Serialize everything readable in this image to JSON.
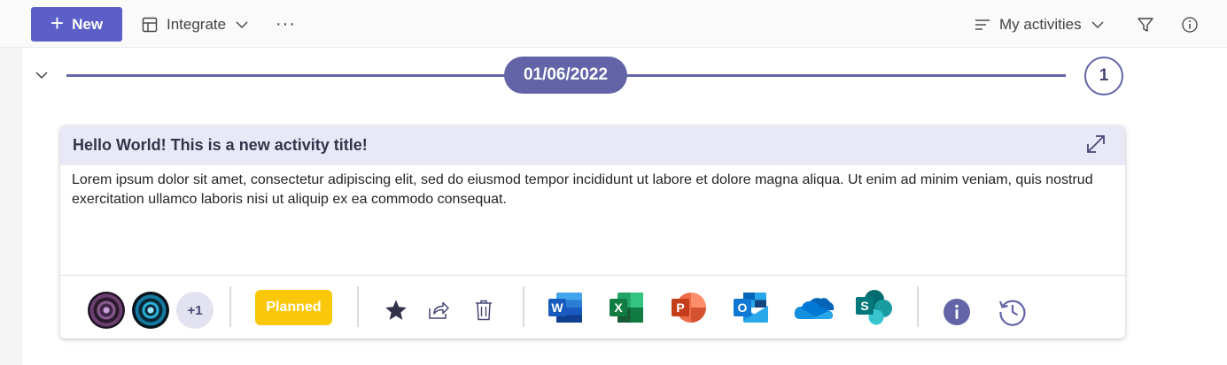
{
  "toolbar": {
    "new_label": "New",
    "integrate_label": "Integrate",
    "more_label": "···",
    "view_label": "My activities"
  },
  "timeline": {
    "date": "01/06/2022",
    "count": "1"
  },
  "activity": {
    "title": "Hello World! This is a new activity title!",
    "description": "Lorem ipsum dolor sit amet, consectetur adipiscing elit, sed do eiusmod tempor incididunt ut labore et dolore magna aliqua. Ut enim ad minim veniam, quis nostrud exercitation ullamco laboris nisi ut aliquip ex ea commodo consequat.",
    "participants_more": "+1",
    "status": "Planned"
  },
  "colors": {
    "accent": "#5b5fc7",
    "timeline": "#6264a7",
    "header_bg": "#e8e8f7",
    "status_planned": "#fbc70b"
  },
  "icons": [
    "plus-icon",
    "integrate-icon",
    "chevron-down-icon",
    "more-icon",
    "list-icon",
    "filter-icon",
    "info-icon",
    "expand-icon",
    "star-icon",
    "share-icon",
    "delete-icon",
    "word-icon",
    "excel-icon",
    "powerpoint-icon",
    "outlook-icon",
    "onedrive-icon",
    "sharepoint-icon",
    "history-icon"
  ]
}
